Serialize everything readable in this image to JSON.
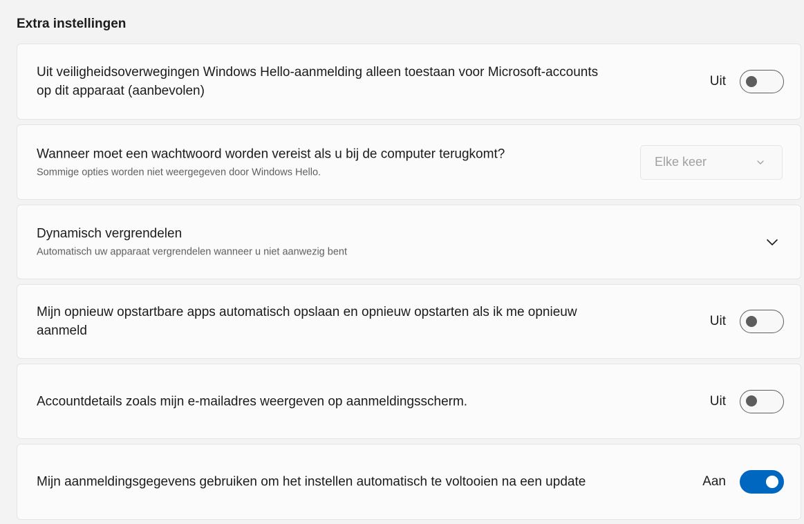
{
  "section_title": "Extra instellingen",
  "items": [
    {
      "title": "Uit veiligheidsoverwegingen Windows Hello-aanmelding alleen toestaan voor Microsoft-accounts op dit apparaat (aanbevolen)",
      "state_label": "Uit",
      "toggle_on": false
    },
    {
      "title": "Wanneer moet een wachtwoord worden vereist als u bij de computer terugkomt?",
      "description": "Sommige opties worden niet weergegeven door Windows Hello.",
      "dropdown_value": "Elke keer",
      "dropdown_disabled": true
    },
    {
      "title": "Dynamisch vergrendelen",
      "description": "Automatisch uw apparaat vergrendelen wanneer u niet aanwezig bent",
      "control_icon": "chevron-down-icon"
    },
    {
      "title": "Mijn opnieuw opstartbare apps automatisch opslaan en opnieuw opstarten als ik me opnieuw aanmeld",
      "state_label": "Uit",
      "toggle_on": false
    },
    {
      "title": "Accountdetails zoals mijn e-mailadres weergeven op aanmeldingsscherm.",
      "state_label": "Uit",
      "toggle_on": false
    },
    {
      "title": "Mijn aanmeldingsgegevens gebruiken om het instellen automatisch te voltooien na een update",
      "state_label": "Aan",
      "toggle_on": true
    }
  ],
  "colors": {
    "accent": "#0067c0",
    "background": "#f3f3f3",
    "card": "#fbfbfb",
    "secondary_text": "#5f5f5f"
  }
}
